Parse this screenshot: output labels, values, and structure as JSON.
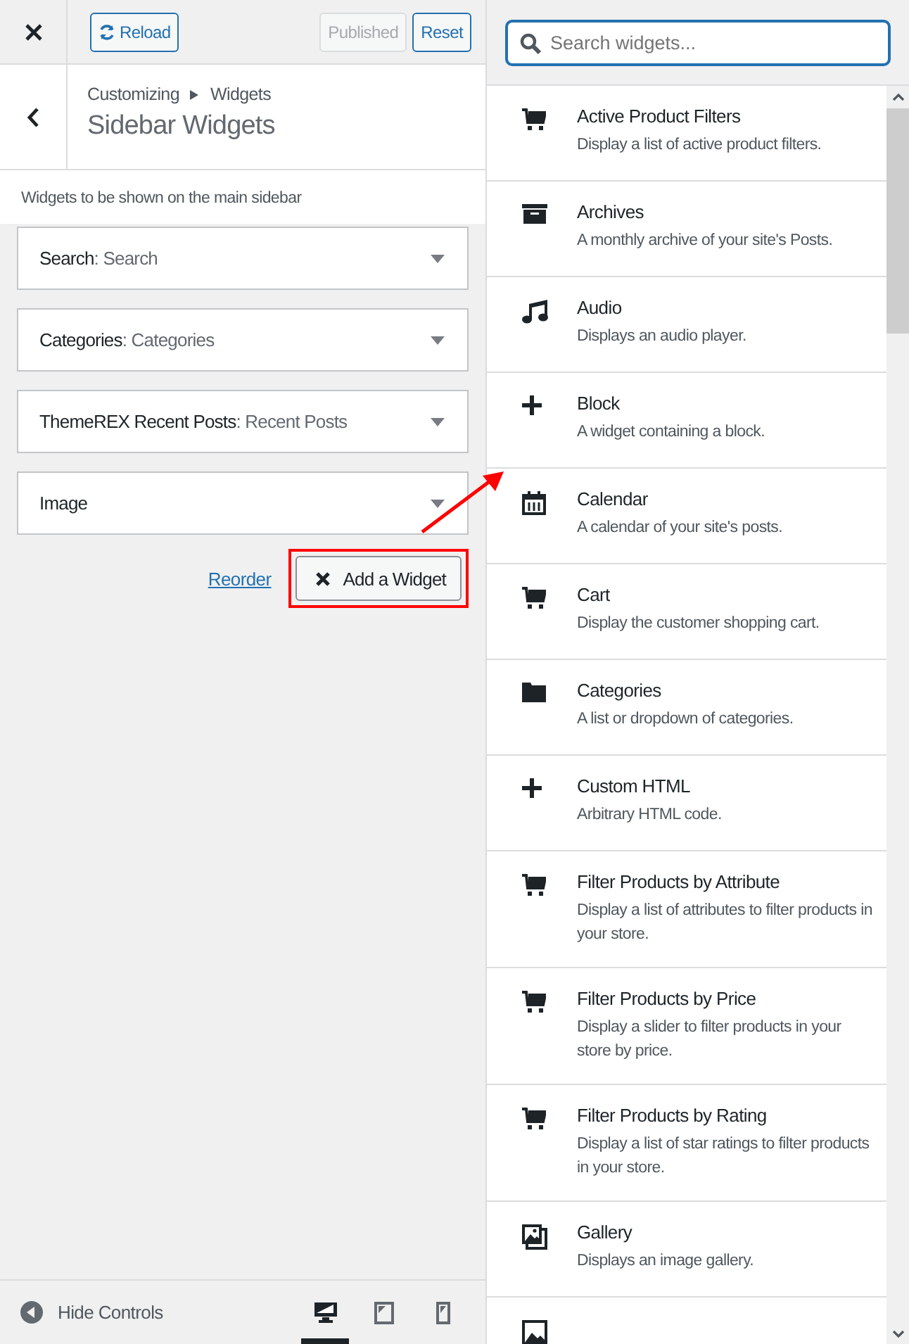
{
  "top_bar": {
    "reload": "Reload",
    "published": {
      "label": "Published",
      "disabled": true
    },
    "reset": "Reset"
  },
  "header": {
    "breadcrumb": [
      "Customizing",
      "Widgets"
    ],
    "title": "Sidebar Widgets"
  },
  "description": "Widgets to be shown on the main sidebar",
  "sidebar_widgets": [
    {
      "type": "Search",
      "title": ": Search"
    },
    {
      "type": "Categories",
      "title": ": Categories"
    },
    {
      "type": "ThemeREX Recent Posts",
      "title": ": Recent Posts"
    },
    {
      "type": "Image"
    }
  ],
  "reorder": "Reorder",
  "add_widget": {
    "label": "Add a Widget",
    "highlighted": true
  },
  "search": {
    "placeholder": "Search widgets..."
  },
  "available_widgets": [
    {
      "kind": "cart",
      "title": "Active Product Filters",
      "description": "Display a list of active product filters."
    },
    {
      "kind": "archive",
      "title": "Archives",
      "description": "A monthly archive of your site's Posts."
    },
    {
      "kind": "music",
      "title": "Audio",
      "description": "Displays an audio player."
    },
    {
      "kind": "plus",
      "title": "Block",
      "description": "A widget containing a block."
    },
    {
      "kind": "calendar",
      "title": "Calendar",
      "description": "A calendar of your site's posts."
    },
    {
      "kind": "cart",
      "title": "Cart",
      "description": "Display the customer shopping cart."
    },
    {
      "kind": "folder",
      "title": "Categories",
      "description": "A list or dropdown of categories."
    },
    {
      "kind": "plus",
      "title": "Custom HTML",
      "description": "Arbitrary HTML code."
    },
    {
      "kind": "cart",
      "title": "Filter Products by Attribute",
      "description": "Display a list of attributes to filter products in your store."
    },
    {
      "kind": "cart",
      "title": "Filter Products by Price",
      "description": "Display a slider to filter products in your store by price."
    },
    {
      "kind": "cart",
      "title": "Filter Products by Rating",
      "description": "Display a list of star ratings to filter products in your store."
    },
    {
      "kind": "gallery",
      "title": "Gallery",
      "description": "Displays an image gallery."
    },
    {
      "kind": "image"
    }
  ],
  "footer": {
    "hide_controls": "Hide Controls",
    "devices": [
      {
        "kind": "desktop",
        "selected": true
      },
      {
        "kind": "tablet",
        "selected": false
      },
      {
        "kind": "mobile",
        "selected": false
      }
    ]
  }
}
